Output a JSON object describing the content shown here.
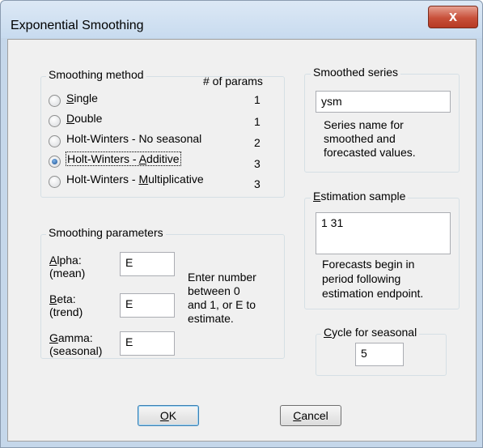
{
  "window": {
    "title": "Exponential Smoothing",
    "close_glyph": "x"
  },
  "smoothing_method": {
    "title": "Smoothing method",
    "params_header": "# of params",
    "options": [
      {
        "mnemonic": "S",
        "rest": "ingle",
        "params": "1",
        "selected": false
      },
      {
        "mnemonic": "D",
        "rest": "ouble",
        "params": "1",
        "selected": false
      },
      {
        "label": "Holt-Winters - No seasonal",
        "params": "2",
        "selected": false
      },
      {
        "prefix": "Holt-Winters - ",
        "mnemonic": "A",
        "rest": "dditive",
        "params": "3",
        "selected": true
      },
      {
        "prefix": "Holt-Winters - ",
        "mnemonic": "M",
        "rest": "ultiplicative",
        "params": "3",
        "selected": false
      }
    ]
  },
  "smoothed_series": {
    "title": "Smoothed series",
    "value": "ysm",
    "help_lines": [
      "Series name for",
      "smoothed and",
      "forecasted values."
    ]
  },
  "estimation_sample": {
    "title_mnemonic": "E",
    "title_rest": "stimation sample",
    "value": "1 31",
    "help_lines": [
      "Forecasts begin in",
      "period following",
      "estimation endpoint."
    ]
  },
  "smoothing_parameters": {
    "title": "Smoothing parameters",
    "alpha": {
      "mnemonic": "A",
      "rest": "lpha:",
      "sub": "(mean)",
      "value": "E"
    },
    "beta": {
      "mnemonic": "B",
      "rest": "eta:",
      "sub": "(trend)",
      "value": "E"
    },
    "gamma": {
      "mnemonic": "G",
      "rest": "amma:",
      "sub": "(seasonal)",
      "value": "E"
    },
    "help_lines": [
      "Enter number",
      "between  0",
      "and 1, or E to",
      "estimate."
    ]
  },
  "cycle": {
    "title_mnemonic": "C",
    "title_rest": "ycle for seasonal",
    "value": "5"
  },
  "buttons": {
    "ok": {
      "mnemonic": "O",
      "rest": "K"
    },
    "cancel": {
      "mnemonic": "C",
      "rest": "ancel"
    }
  }
}
